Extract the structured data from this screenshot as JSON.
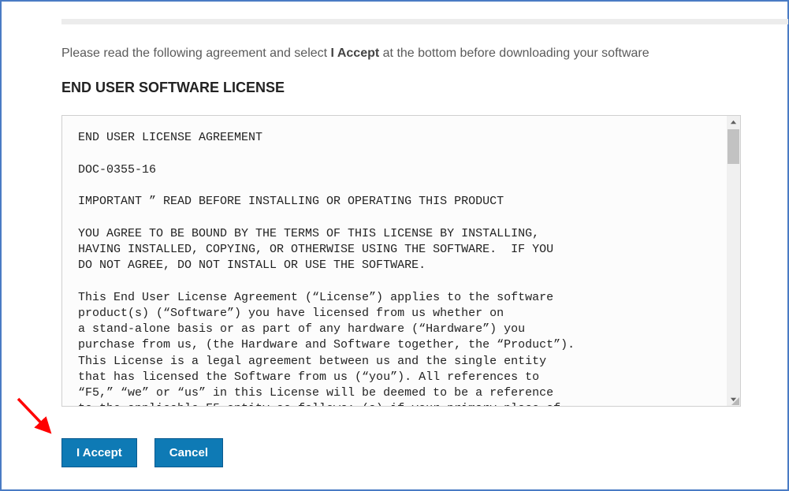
{
  "instruction": {
    "prefix": "Please read the following agreement and select ",
    "bold": "I Accept",
    "suffix": " at the bottom before downloading your software"
  },
  "heading": "END USER SOFTWARE LICENSE",
  "license_text": "END USER LICENSE AGREEMENT\n\nDOC-0355-16\n\nIMPORTANT ” READ BEFORE INSTALLING OR OPERATING THIS PRODUCT\n\nYOU AGREE TO BE BOUND BY THE TERMS OF THIS LICENSE BY INSTALLING,\nHAVING INSTALLED, COPYING, OR OTHERWISE USING THE SOFTWARE.  IF YOU\nDO NOT AGREE, DO NOT INSTALL OR USE THE SOFTWARE.\n\nThis End User License Agreement (“License”) applies to the software\nproduct(s) (“Software”) you have licensed from us whether on\na stand-alone basis or as part of any hardware (“Hardware”) you\npurchase from us, (the Hardware and Software together, the “Product”).\nThis License is a legal agreement between us and the single entity\nthat has licensed the Software from us (“you”). All references to\n“F5,” “we” or “us” in this License will be deemed to be a reference\nto the applicable F5 entity as follows: (a) if your primary place of\nbusiness is located in the European Economic Area, the Middle East",
  "buttons": {
    "accept": "I Accept",
    "cancel": "Cancel"
  }
}
